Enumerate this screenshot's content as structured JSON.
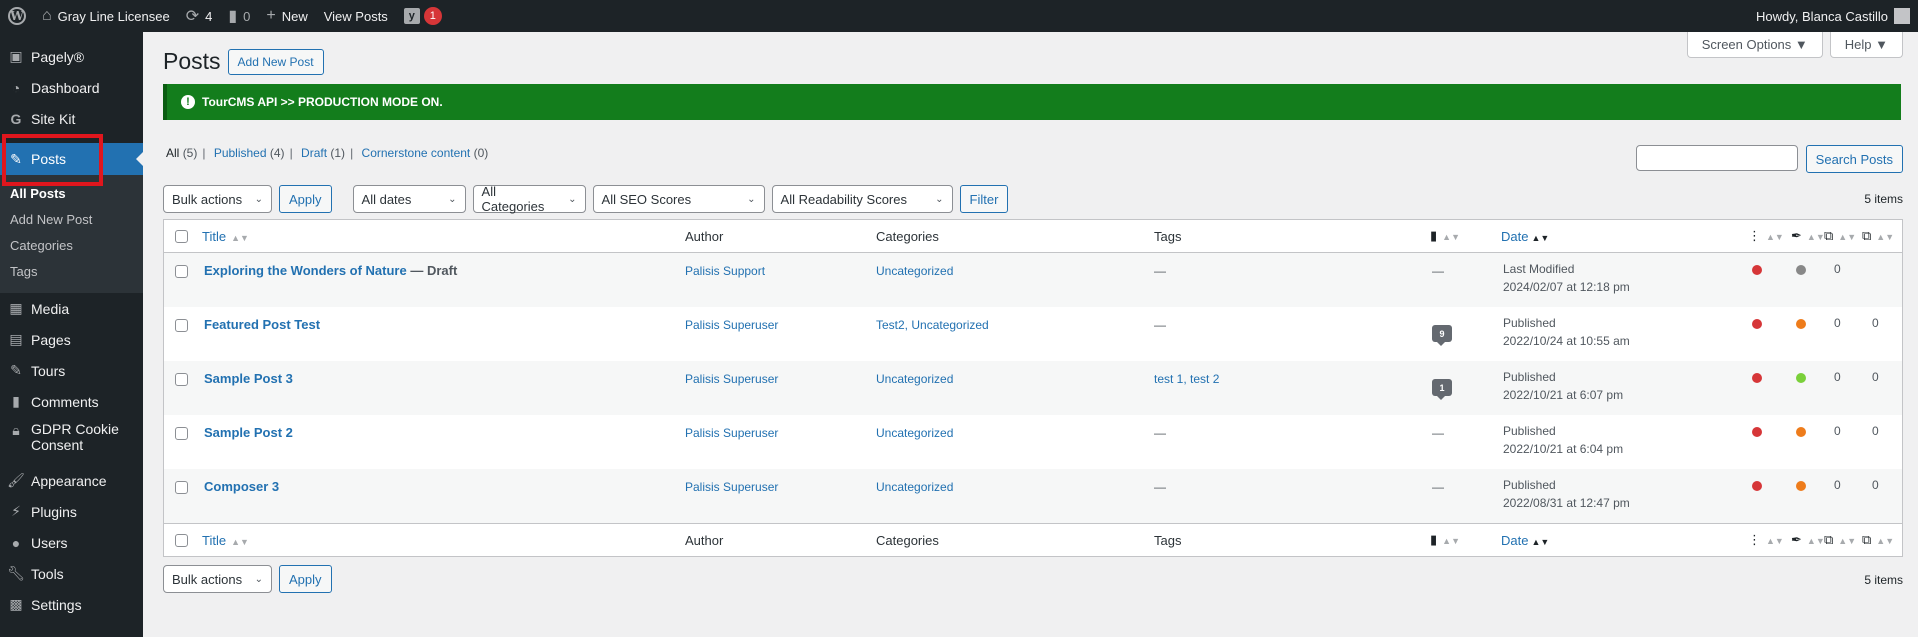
{
  "adminbar": {
    "site_name": "Gray Line Licensee",
    "updates_count": "4",
    "comments_count": "0",
    "new_label": "New",
    "view_posts_label": "View Posts",
    "yoast_badge": "1",
    "howdy": "Howdy, Blanca Castillo"
  },
  "sidebar": {
    "items": [
      {
        "label": "Pagely®",
        "icon": "pagely-icon"
      },
      {
        "label": "Dashboard",
        "icon": "dashboard-icon"
      },
      {
        "label": "Site Kit",
        "icon": "google-icon"
      },
      {
        "label": "Posts",
        "icon": "pin-icon"
      },
      {
        "label": "Media",
        "icon": "media-icon"
      },
      {
        "label": "Pages",
        "icon": "pages-icon"
      },
      {
        "label": "Tours",
        "icon": "pin-icon"
      },
      {
        "label": "Comments",
        "icon": "comment-icon"
      },
      {
        "label": "GDPR Cookie Consent",
        "icon": "lock-icon"
      },
      {
        "label": "Appearance",
        "icon": "brush-icon"
      },
      {
        "label": "Plugins",
        "icon": "plug-icon"
      },
      {
        "label": "Users",
        "icon": "user-icon"
      },
      {
        "label": "Tools",
        "icon": "wrench-icon"
      },
      {
        "label": "Settings",
        "icon": "settings-icon"
      }
    ],
    "posts_submenu": [
      "All Posts",
      "Add New Post",
      "Categories",
      "Tags"
    ]
  },
  "screen_meta": {
    "screen_options": "Screen Options ▼",
    "help": "Help ▼"
  },
  "page": {
    "title": "Posts",
    "add_new": "Add New Post"
  },
  "notice": {
    "text": "TourCMS API >> PRODUCTION MODE ON."
  },
  "views": {
    "all": "All",
    "all_count": "(5)",
    "published": "Published",
    "published_count": "(4)",
    "draft": "Draft",
    "draft_count": "(1)",
    "cornerstone": "Cornerstone content",
    "cornerstone_count": "(0)"
  },
  "search": {
    "button": "Search Posts"
  },
  "filters": {
    "bulk_actions": "Bulk actions",
    "apply": "Apply",
    "dates": "All dates",
    "categories": "All Categories",
    "seo": "All SEO Scores",
    "readability": "All Readability Scores",
    "filter": "Filter",
    "items_count": "5 items"
  },
  "columns": {
    "title": "Title",
    "author": "Author",
    "categories": "Categories",
    "tags": "Tags",
    "date": "Date"
  },
  "colors": {
    "red": "#d63638",
    "orange": "#ee7c1b",
    "green": "#7ad03a",
    "gray": "#888888"
  },
  "rows": [
    {
      "title": "Exploring the Wonders of Nature",
      "state": "— Draft",
      "author": "Palisis Support",
      "categories": "Uncategorized",
      "tags": "—",
      "comments": "—",
      "date_status": "Last Modified",
      "date": "2024/02/07 at 12:18 pm",
      "seo": "red",
      "read": "gray",
      "c1": "0",
      "c2": ""
    },
    {
      "title": "Featured Post Test",
      "state": "",
      "author": "Palisis Superuser",
      "categories": "Test2, Uncategorized",
      "tags": "—",
      "comments": "9",
      "date_status": "Published",
      "date": "2022/10/24 at 10:55 am",
      "seo": "red",
      "read": "orange",
      "c1": "0",
      "c2": "0"
    },
    {
      "title": "Sample Post 3",
      "state": "",
      "author": "Palisis Superuser",
      "categories": "Uncategorized",
      "tags": "test 1, test 2",
      "comments": "1",
      "date_status": "Published",
      "date": "2022/10/21 at 6:07 pm",
      "seo": "red",
      "read": "green",
      "c1": "0",
      "c2": "0"
    },
    {
      "title": "Sample Post 2",
      "state": "",
      "author": "Palisis Superuser",
      "categories": "Uncategorized",
      "tags": "—",
      "comments": "—",
      "date_status": "Published",
      "date": "2022/10/21 at 6:04 pm",
      "seo": "red",
      "read": "orange",
      "c1": "0",
      "c2": "0"
    },
    {
      "title": "Composer 3",
      "state": "",
      "author": "Palisis Superuser",
      "categories": "Uncategorized",
      "tags": "—",
      "comments": "—",
      "date_status": "Published",
      "date": "2022/08/31 at 12:47 pm",
      "seo": "red",
      "read": "orange",
      "c1": "0",
      "c2": "0"
    }
  ]
}
